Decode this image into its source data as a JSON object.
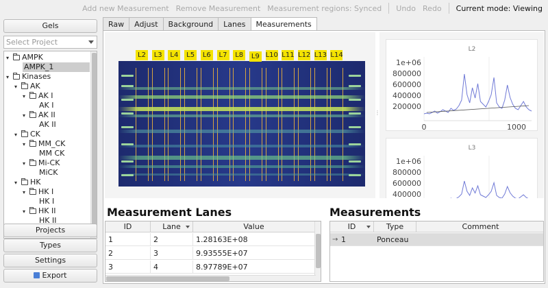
{
  "toolbar": {
    "add_measurement": "Add new Measurement",
    "remove_measurement": "Remove Measurement",
    "regions": "Measurement regions: Synced",
    "undo": "Undo",
    "redo": "Redo",
    "mode": "Current mode: Viewing"
  },
  "sidebar": {
    "gels_button": "Gels",
    "select_project_placeholder": "Select Project",
    "tree": [
      {
        "label": "AMPK",
        "depth": 0,
        "expanded": true,
        "folder": true
      },
      {
        "label": "AMPK_1",
        "depth": 1,
        "folder": false,
        "selected": true
      },
      {
        "label": "Kinases",
        "depth": 0,
        "expanded": true,
        "folder": true
      },
      {
        "label": "AK",
        "depth": 1,
        "expanded": true,
        "folder": true
      },
      {
        "label": "AK I",
        "depth": 2,
        "expanded": true,
        "folder": true
      },
      {
        "label": "AK I",
        "depth": 3,
        "folder": false
      },
      {
        "label": "AK II",
        "depth": 2,
        "expanded": true,
        "folder": true
      },
      {
        "label": "AK II",
        "depth": 3,
        "folder": false
      },
      {
        "label": "CK",
        "depth": 1,
        "expanded": true,
        "folder": true
      },
      {
        "label": "MM_CK",
        "depth": 2,
        "expanded": true,
        "folder": true
      },
      {
        "label": "MM CK",
        "depth": 3,
        "folder": false
      },
      {
        "label": "Mi-CK",
        "depth": 2,
        "expanded": true,
        "folder": true
      },
      {
        "label": "MiCK",
        "depth": 3,
        "folder": false
      },
      {
        "label": "HK",
        "depth": 1,
        "expanded": true,
        "folder": true
      },
      {
        "label": "HK I",
        "depth": 2,
        "expanded": true,
        "folder": true
      },
      {
        "label": "HK I",
        "depth": 3,
        "folder": false
      },
      {
        "label": "HK II",
        "depth": 2,
        "expanded": true,
        "folder": true
      },
      {
        "label": "HK II",
        "depth": 3,
        "folder": false
      }
    ],
    "projects_button": "Projects",
    "types_button": "Types",
    "settings_button": "Settings",
    "export_button": "Export"
  },
  "tabs": [
    {
      "label": "Raw",
      "active": false
    },
    {
      "label": "Adjust",
      "active": false
    },
    {
      "label": "Background",
      "active": false
    },
    {
      "label": "Lanes",
      "active": false
    },
    {
      "label": "Measurements",
      "active": true
    }
  ],
  "gel": {
    "lanes": [
      "L2",
      "L3",
      "L4",
      "L5",
      "L6",
      "L7",
      "L8",
      "L9",
      "L10",
      "L11",
      "L12",
      "L13",
      "L14"
    ]
  },
  "plots": [
    {
      "title": "L2",
      "yticks": [
        "1e+06",
        "800000",
        "600000",
        "400000",
        "200000"
      ],
      "xticks": [
        "0",
        "1000"
      ]
    },
    {
      "title": "L3",
      "yticks": [
        "1e+06",
        "800000",
        "600000",
        "400000"
      ],
      "xticks": []
    }
  ],
  "lanes_table": {
    "heading": "Measurement Lanes",
    "columns": [
      "ID",
      "Lane",
      "Value"
    ],
    "rows": [
      {
        "id": "1",
        "lane": "2",
        "value": "1.28163E+08"
      },
      {
        "id": "2",
        "lane": "3",
        "value": "9.93555E+07"
      },
      {
        "id": "3",
        "lane": "4",
        "value": "8.97789E+07"
      }
    ]
  },
  "measurements_table": {
    "heading": "Measurements",
    "columns": [
      "ID",
      "Type",
      "Comment"
    ],
    "rows": [
      {
        "id": "1",
        "type": "Ponceau",
        "comment": ""
      }
    ]
  }
}
